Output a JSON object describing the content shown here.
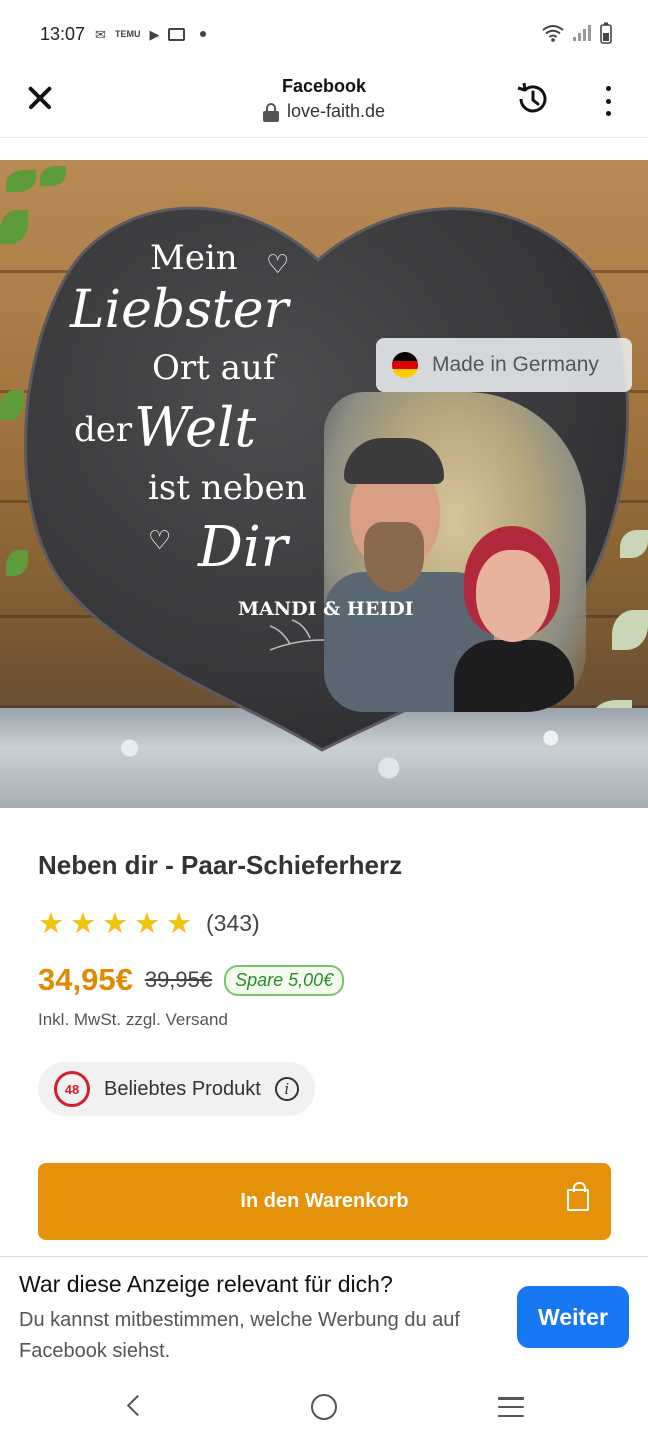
{
  "status": {
    "time": "13:07",
    "notif_temu": "TEMU"
  },
  "header": {
    "title": "Facebook",
    "url": "love-faith.de"
  },
  "hero": {
    "badge": "Made in Germany",
    "slate_lines": [
      "Mein",
      "Liebster",
      "Ort auf",
      "der",
      "Welt",
      "ist neben",
      "Dir"
    ],
    "names": "MANDI & HEIDI",
    "colors": {
      "flag": [
        "#000000",
        "#dd0000",
        "#ffcc00"
      ]
    }
  },
  "product": {
    "title": "Neben dir - Paar-Schieferherz",
    "rating": 5,
    "review_count": "(343)",
    "price": "34,95€",
    "old_price": "39,95€",
    "save": "Spare 5,00€",
    "tax_note": "Inkl. MwSt. zzgl. Versand",
    "popular_badge_number": "48",
    "popular_label": "Beliebtes Produkt",
    "info_symbol": "i",
    "cart_button": "In den Warenkorb",
    "accent": "#e5920a"
  },
  "prompt": {
    "title": "War diese Anzeige relevant für dich?",
    "text": "Du kannst mitbestimmen, welche Werbung du auf Facebook siehst.",
    "button": "Weiter",
    "button_color": "#1877f2"
  },
  "icons": [
    "close-icon",
    "lock-icon",
    "history-icon",
    "more-vert-icon",
    "star-icon",
    "info-icon",
    "bag-icon",
    "nav-back-icon",
    "nav-home-icon",
    "nav-recent-icon"
  ]
}
